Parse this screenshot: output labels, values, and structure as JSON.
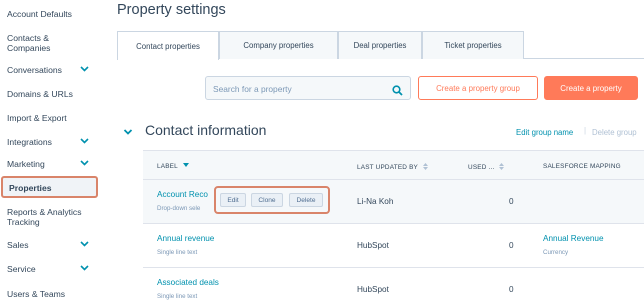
{
  "sidebar": {
    "items": [
      {
        "label": "Account Defaults",
        "chevron": false
      },
      {
        "label": "Contacts & Companies",
        "chevron": false
      },
      {
        "label": "Conversations",
        "chevron": true
      },
      {
        "label": "Domains & URLs",
        "chevron": false
      },
      {
        "label": "Import & Export",
        "chevron": false
      },
      {
        "label": "Integrations",
        "chevron": true
      },
      {
        "label": "Marketing",
        "chevron": true
      },
      {
        "label": "Properties",
        "chevron": false,
        "active": true
      },
      {
        "label": "Reports & Analytics Tracking",
        "chevron": false
      },
      {
        "label": "Sales",
        "chevron": true
      },
      {
        "label": "Service",
        "chevron": true
      },
      {
        "label": "Users & Teams",
        "chevron": false
      }
    ]
  },
  "header": {
    "title": "Property settings"
  },
  "tabs": [
    {
      "label": "Contact properties",
      "active": true
    },
    {
      "label": "Company properties",
      "active": false
    },
    {
      "label": "Deal properties",
      "active": false
    },
    {
      "label": "Ticket properties",
      "active": false
    }
  ],
  "search": {
    "placeholder": "Search for a property",
    "icon": "search-icon"
  },
  "buttons": {
    "create_group": "Create a property group",
    "create_property": "Create a property"
  },
  "section": {
    "title": "Contact information",
    "edit_link": "Edit group name",
    "separator": "|",
    "delete_link": "Delete group"
  },
  "table": {
    "columns": {
      "label": "LABEL",
      "updated_by": "LAST UPDATED BY",
      "used": "USED ...",
      "mapping": "SALESFORCE MAPPING"
    },
    "rows": [
      {
        "name": "Account Reco",
        "type": "Drop-down sele",
        "updated_by": "Li-Na Koh",
        "used": "0",
        "mapping": "",
        "mapping_type": ""
      },
      {
        "name": "Annual revenue",
        "type": "Single line text",
        "updated_by": "HubSpot",
        "used": "0",
        "mapping": "Annual Revenue",
        "mapping_type": "Currency"
      },
      {
        "name": "Associated deals",
        "type": "Single line text",
        "updated_by": "HubSpot",
        "used": "0",
        "mapping": "",
        "mapping_type": ""
      }
    ],
    "row_actions": {
      "edit": "Edit",
      "clone": "Clone",
      "delete": "Delete"
    }
  },
  "colors": {
    "accent": "#ff7a59",
    "link": "#0091ae",
    "text": "#33475b",
    "highlight_outline": "#d9846a"
  }
}
